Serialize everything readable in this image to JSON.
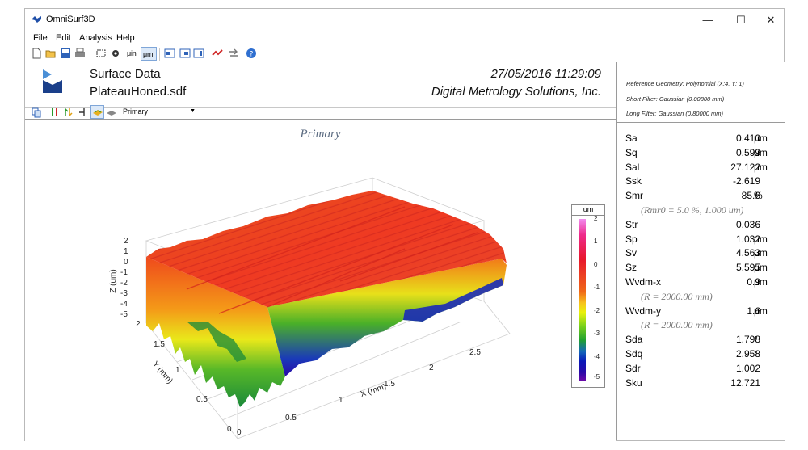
{
  "window": {
    "title": "OmniSurf3D",
    "controls": {
      "minimize": "—",
      "maximize": "☐",
      "close": "✕"
    }
  },
  "menu": {
    "items": [
      "File",
      "Edit",
      "Analysis",
      "Help"
    ]
  },
  "toolbar": {
    "unit_uin": "μin",
    "unit_um": "μm"
  },
  "header": {
    "title": "Surface Data",
    "filename": "PlateauHoned.sdf",
    "datetime": "27/05/2016  11:29:09",
    "company": "Digital Metrology Solutions, Inc."
  },
  "toolbar2": {
    "view_select": "Primary"
  },
  "plot": {
    "title": "Primary",
    "z_axis_label": "Z (um)",
    "y_axis_label": "Y (mm)",
    "x_axis_label": "X (mm)",
    "z_ticks": [
      "2",
      "1",
      "0",
      "-1",
      "-2",
      "-3",
      "-4",
      "-5"
    ],
    "y_ticks": [
      "2",
      "1.5",
      "1",
      "0.5",
      "0"
    ],
    "x_ticks": [
      "0",
      "0.5",
      "1",
      "1.5",
      "2",
      "2.5"
    ],
    "legend": {
      "unit": "um",
      "ticks": [
        "2",
        "1",
        "0",
        "-1",
        "-2",
        "-3",
        "-4",
        "-5"
      ],
      "range": [
        -5,
        2
      ]
    },
    "colors": {
      "red": "#e8382a",
      "orange": "#f2801c",
      "yellow": "#e6e81a",
      "green": "#3aa82a",
      "blue": "#1a2ab8"
    }
  },
  "right_panel": {
    "info": [
      "Reference Geometry: Polynomial (X:4,  Y: 1)",
      "Short Filter: Gaussian (0.00800 mm)",
      "Long Filter: Gaussian (0.80000 mm)"
    ],
    "params": [
      {
        "name": "Sa",
        "value": "0.410",
        "unit": "μm"
      },
      {
        "name": "Sq",
        "value": "0.599",
        "unit": "μm"
      },
      {
        "name": "Sal",
        "value": "27.122",
        "unit": "μm"
      },
      {
        "name": "Ssk",
        "value": "-2.619",
        "unit": ""
      },
      {
        "name": "Smr",
        "value": "85.6",
        "unit": "%"
      },
      {
        "note": "(Rmr0 = 5.0 %,  1.000 um)"
      },
      {
        "name": "Str",
        "value": "0.036",
        "unit": ""
      },
      {
        "name": "Sp",
        "value": "1.032",
        "unit": "μm"
      },
      {
        "name": "Sv",
        "value": "4.563",
        "unit": "μm"
      },
      {
        "name": "Sz",
        "value": "5.595",
        "unit": "μm"
      },
      {
        "name": "Wvdm-x",
        "value": "0.9",
        "unit": "μm"
      },
      {
        "note": "(R = 2000.00 mm)"
      },
      {
        "name": "Wvdm-y",
        "value": "1.6",
        "unit": "μm"
      },
      {
        "note": "(R = 2000.00 mm)"
      },
      {
        "name": "Sda",
        "value": "1.798",
        "unit": "°"
      },
      {
        "name": "Sdq",
        "value": "2.958",
        "unit": "°"
      },
      {
        "name": "Sdr",
        "value": "1.002",
        "unit": ""
      },
      {
        "name": "Sku",
        "value": "12.721",
        "unit": ""
      }
    ]
  }
}
